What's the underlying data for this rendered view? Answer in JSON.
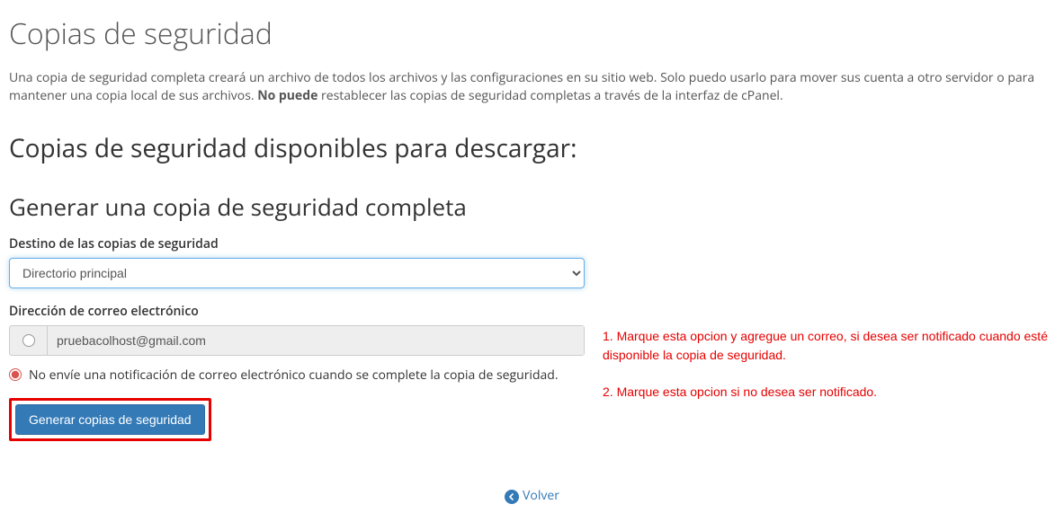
{
  "page": {
    "title": "Copias de seguridad",
    "description_pre": "Una copia de seguridad completa creará un archivo de todos los archivos y las configuraciones en su sitio web. Solo puedo usarlo para mover sus cuenta a otro servidor o para mantener una copia local de sus archivos. ",
    "description_strong": "No puede",
    "description_post": " restablecer las copias de seguridad completas a través de la interfaz de cPanel."
  },
  "sections": {
    "available_title": "Copias de seguridad disponibles para descargar:",
    "generate_title": "Generar una copia de seguridad completa"
  },
  "form": {
    "destination_label": "Destino de las copias de seguridad",
    "destination_value": "Directorio principal",
    "email_label": "Dirección de correo electrónico",
    "email_value": "pruebacolhost@gmail.com",
    "no_notify_label": "No envíe una notificación de correo electrónico cuando se complete la copia de seguridad.",
    "submit_label": "Generar copias de seguridad"
  },
  "annotations": {
    "note1": "1. Marque esta opcion y agregue un correo, si desea ser notificado cuando esté disponible la copia de seguridad.",
    "note2": "2. Marque esta opcion si no desea ser notificado."
  },
  "footer": {
    "back_label": "Volver"
  }
}
